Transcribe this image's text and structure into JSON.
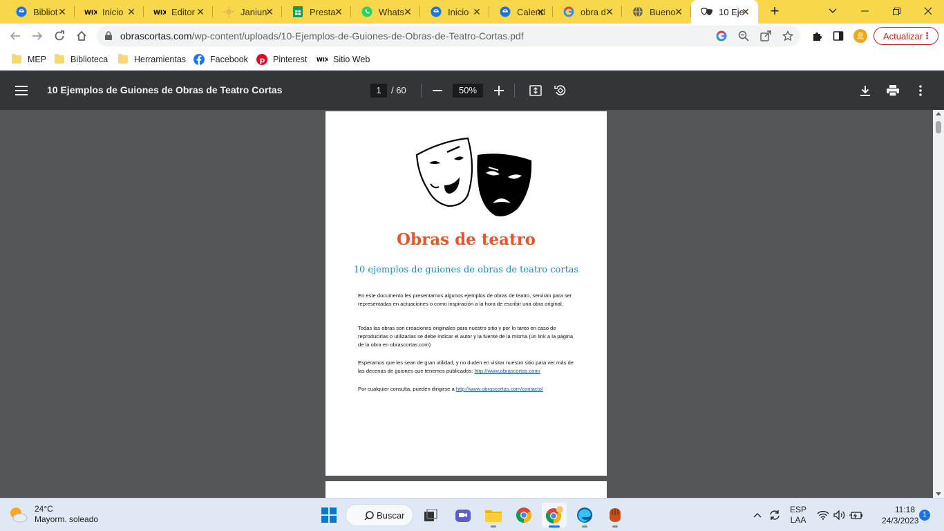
{
  "tabs": [
    {
      "title": "Bibliot",
      "icon": "edge-blue-icon"
    },
    {
      "title": "Inicio",
      "icon": "wix-icon"
    },
    {
      "title": "Editor",
      "icon": "wix-icon"
    },
    {
      "title": "Janiun",
      "icon": "sun-icon"
    },
    {
      "title": "Presta",
      "icon": "sheets-icon"
    },
    {
      "title": "Whats",
      "icon": "whatsapp-icon"
    },
    {
      "title": "Inicio",
      "icon": "edge-blue-icon"
    },
    {
      "title": "Calend",
      "icon": "edge-blue-icon"
    },
    {
      "title": "obra d",
      "icon": "google-icon"
    },
    {
      "title": "Bueno",
      "icon": "globe-icon"
    },
    {
      "title": "10 Eje",
      "icon": "theater-masks-icon",
      "active": true
    }
  ],
  "omnibox": {
    "host": "obrascortas.com",
    "path": "/wp-content/uploads/10-Ejemplos-de-Guiones-de-Obras-de-Teatro-Cortas.pdf"
  },
  "update_button": "Actualizar",
  "bookmarks": [
    {
      "label": "MEP",
      "icon": "folder-icon"
    },
    {
      "label": "Biblioteca",
      "icon": "folder-icon"
    },
    {
      "label": "Herramientas",
      "icon": "folder-icon"
    },
    {
      "label": "Facebook",
      "icon": "facebook-icon"
    },
    {
      "label": "Pinterest",
      "icon": "pinterest-icon"
    },
    {
      "label": "Sitio Web",
      "icon": "wix-icon"
    }
  ],
  "pdf": {
    "title": "10 Ejemplos de Guiones de Obras de Teatro Cortas",
    "current_page": "1",
    "total_pages": "/ 60",
    "zoom": "50%"
  },
  "document": {
    "heading": "Obras de teatro",
    "subheading": "10 ejemplos de guiones de obras de teatro cortas",
    "para1": "En este documento les presentamos algunos ejemplos de obras de teatro, servirán para ser representadas en actuaciones o como inspiración a la hora de escribir una obra original.",
    "para2": "Todas las obras son creaciones originales para nuestro sitio y por lo tanto en caso de reproducirlas o utilizarlas se debe indicar el autor y la fuente de la misma (un link a la página de la obra en obrascortas.com)",
    "para3_text": "Esperamos que les sean de gran utilidad, y no duden en visitar nuestro sitio para ver más de las decenas de guiones que tenemos publicados: ",
    "para3_link": "http://www.obrascortas.com/",
    "para4_text": "Por cualquier consulta, pueden dirigirse a ",
    "para4_link": "http://www.obrascortas.com/contacto/"
  },
  "taskbar": {
    "temperature": "24°C",
    "weather": "Mayorm. soleado",
    "search": "Buscar",
    "language": "ESP",
    "layout": "LAA",
    "time": "11:18",
    "date": "24/3/2023",
    "notifications": "1"
  },
  "colors": {
    "tabstrip": "#f6d84a",
    "heading": "#e8552a",
    "subheading": "#1a8bc6",
    "pdf_toolbar": "#323639",
    "update": "#c5221f"
  }
}
